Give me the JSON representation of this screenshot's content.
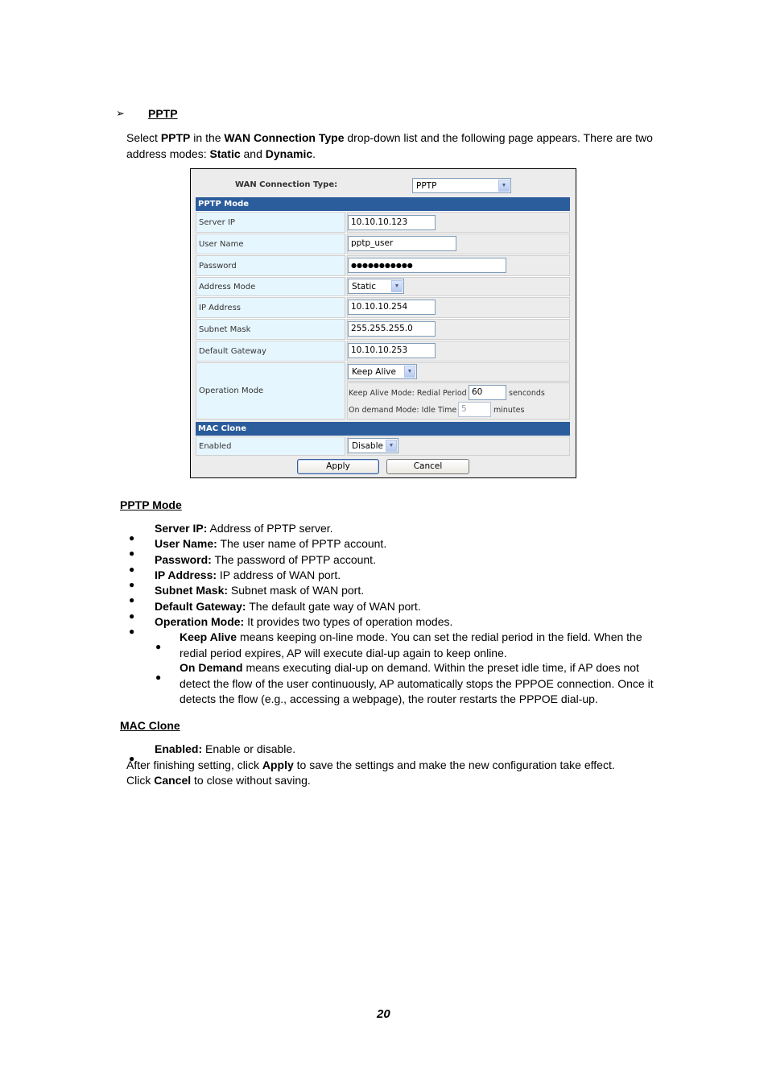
{
  "heading": {
    "marker": "➢",
    "title": "PPTP"
  },
  "intro": {
    "p1": "Select ",
    "b1": "PPTP",
    "p2": " in the ",
    "b2": "WAN Connection Type",
    "p3": " drop-down list and the following page appears. There are two address modes: ",
    "b3": "Static",
    "p4": " and ",
    "b4": "Dynamic",
    "p5": "."
  },
  "ui": {
    "wan_connection_type_label": "WAN Connection Type:",
    "wan_connection_type_value": "PPTP",
    "pptp_section": "PPTP Mode",
    "fields": {
      "server_ip": {
        "label": "Server IP",
        "value": "10.10.10.123"
      },
      "user_name": {
        "label": "User Name",
        "value": "pptp_user"
      },
      "password": {
        "label": "Password",
        "value": "●●●●●●●●●●●"
      },
      "address_mode": {
        "label": "Address Mode",
        "value": "Static"
      },
      "ip_address": {
        "label": "IP Address",
        "value": "10.10.10.254"
      },
      "subnet_mask": {
        "label": "Subnet Mask",
        "value": "255.255.255.0"
      },
      "default_gateway": {
        "label": "Default Gateway",
        "value": "10.10.10.253"
      },
      "operation_mode": {
        "label": "Operation Mode",
        "value": "Keep Alive",
        "keep_alive_label": "Keep Alive Mode: Redial Period",
        "keep_alive_value": "60",
        "keep_alive_unit": "senconds",
        "on_demand_label": "On demand Mode: Idle Time",
        "on_demand_value": "5",
        "on_demand_unit": "minutes"
      }
    },
    "mac_section": "MAC Clone",
    "mac_enabled": {
      "label": "Enabled",
      "value": "Disable"
    },
    "apply_label": "Apply",
    "cancel_label": "Cancel",
    "colors": {
      "section_bar": "#2b5c9c",
      "label_cell": "#e6f6fe",
      "value_cell": "#ececec"
    }
  },
  "pptp_mode": {
    "title": "PPTP Mode",
    "items": [
      {
        "term": "Server IP:",
        "desc": " Address of PPTP server."
      },
      {
        "term": "User Name:",
        "desc": " The user name of PPTP account."
      },
      {
        "term": "Password:",
        "desc": " The password of PPTP account."
      },
      {
        "term": "IP Address:",
        "desc": " IP address of WAN port."
      },
      {
        "term": "Subnet Mask:",
        "desc": " Subnet mask of WAN port."
      },
      {
        "term": "Default Gateway:",
        "desc": " The default gate way of WAN port."
      },
      {
        "term": "Operation Mode:",
        "desc": " It provides two types of operation modes."
      }
    ],
    "sub_items": [
      {
        "term": "Keep Alive",
        "desc": " means keeping on-line mode. You can set the redial period in the field. When the redial period expires, AP will execute dial-up again to keep online."
      },
      {
        "term": "On Demand",
        "desc": " means executing dial-up on demand. Within the preset idle time, if AP does not detect the flow of the user continuously, AP automatically stops the PPPOE connection. Once it detects the flow (e.g., accessing a webpage), the router restarts the PPPOE dial-up."
      }
    ]
  },
  "mac_clone": {
    "title": "MAC Clone",
    "items": [
      {
        "term": "Enabled:",
        "desc": " Enable or disable."
      }
    ],
    "after_p1": "After finishing setting, click ",
    "after_b1": "Apply",
    "after_p2": " to save the settings and make the new configuration take effect.",
    "after_p3": "Click ",
    "after_b2": "Cancel",
    "after_p4": " to close without saving."
  },
  "page_number": "20"
}
